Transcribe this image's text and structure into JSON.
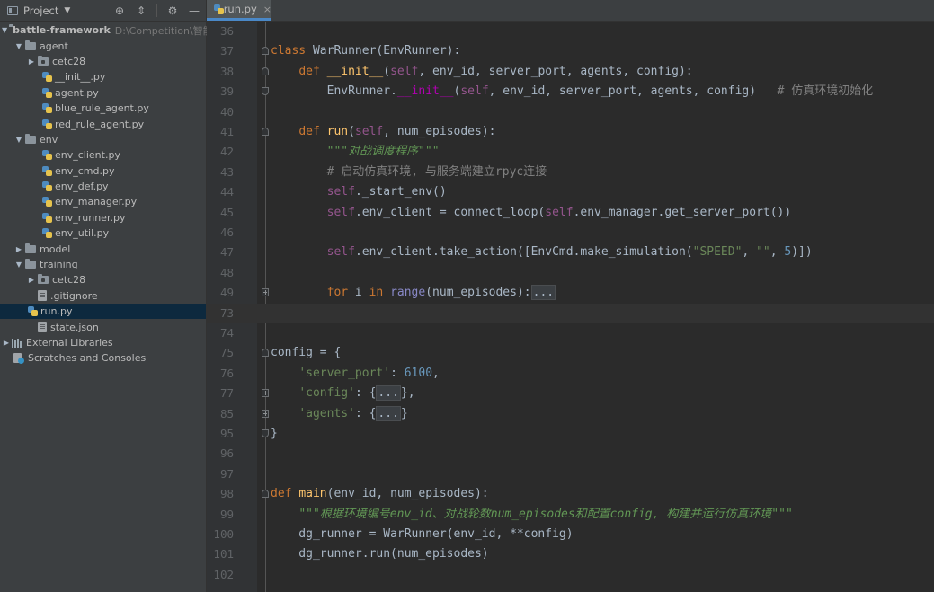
{
  "project_panel": {
    "title": "Project",
    "root_name": "battle-framework",
    "root_path": "D:\\Competition\\智能",
    "items": [
      {
        "label": "agent",
        "type": "folder",
        "expanded": true,
        "depth": 1
      },
      {
        "label": "cetc28",
        "type": "package",
        "expanded": false,
        "depth": 2
      },
      {
        "label": "__init__.py",
        "type": "py",
        "depth": 3
      },
      {
        "label": "agent.py",
        "type": "py",
        "depth": 3
      },
      {
        "label": "blue_rule_agent.py",
        "type": "py",
        "depth": 3
      },
      {
        "label": "red_rule_agent.py",
        "type": "py",
        "depth": 3
      },
      {
        "label": "env",
        "type": "folder",
        "expanded": true,
        "depth": 1
      },
      {
        "label": "env_client.py",
        "type": "py",
        "depth": 3
      },
      {
        "label": "env_cmd.py",
        "type": "py",
        "depth": 3
      },
      {
        "label": "env_def.py",
        "type": "py",
        "depth": 3
      },
      {
        "label": "env_manager.py",
        "type": "py",
        "depth": 3
      },
      {
        "label": "env_runner.py",
        "type": "py",
        "depth": 3
      },
      {
        "label": "env_util.py",
        "type": "py",
        "depth": 3
      },
      {
        "label": "model",
        "type": "folder",
        "expanded": false,
        "depth": 1
      },
      {
        "label": "training",
        "type": "folder",
        "expanded": true,
        "depth": 1
      },
      {
        "label": "cetc28",
        "type": "package",
        "expanded": false,
        "depth": 2
      },
      {
        "label": ".gitignore",
        "type": "file",
        "depth": 2
      },
      {
        "label": "run.py",
        "type": "py",
        "depth": 2,
        "selected": true
      },
      {
        "label": "state.json",
        "type": "file",
        "depth": 2
      },
      {
        "label": "External Libraries",
        "type": "lib",
        "expanded": false,
        "depth": 0
      },
      {
        "label": "Scratches and Consoles",
        "type": "scratch",
        "depth": 0
      }
    ]
  },
  "editor": {
    "tab_label": "run.py",
    "current_line": "73",
    "lines": [
      {
        "n": "36",
        "t": ""
      },
      {
        "n": "37",
        "t": "class WarRunner(EnvRunner):"
      },
      {
        "n": "38",
        "t": "    def __init__(self, env_id, server_port, agents, config):"
      },
      {
        "n": "39",
        "t": "        EnvRunner.__init__(self, env_id, server_port, agents, config)   # 仿真环境初始化"
      },
      {
        "n": "40",
        "t": ""
      },
      {
        "n": "41",
        "t": "    def run(self, num_episodes):"
      },
      {
        "n": "42",
        "t": "        \"\"\"对战调度程序\"\"\""
      },
      {
        "n": "43",
        "t": "        # 启动仿真环境, 与服务端建立rpyc连接"
      },
      {
        "n": "44",
        "t": "        self._start_env()"
      },
      {
        "n": "45",
        "t": "        self.env_client = connect_loop(self.env_manager.get_server_port())"
      },
      {
        "n": "46",
        "t": ""
      },
      {
        "n": "47",
        "t": "        self.env_client.take_action([EnvCmd.make_simulation(\"SPEED\", \"\", 5)])"
      },
      {
        "n": "48",
        "t": ""
      },
      {
        "n": "49",
        "t": "        for i in range(num_episodes):..."
      },
      {
        "n": "73",
        "t": ""
      },
      {
        "n": "74",
        "t": ""
      },
      {
        "n": "75",
        "t": "config = {"
      },
      {
        "n": "76",
        "t": "    'server_port': 6100,"
      },
      {
        "n": "77",
        "t": "    'config': {...},"
      },
      {
        "n": "85",
        "t": "    'agents': {...}"
      },
      {
        "n": "95",
        "t": "}"
      },
      {
        "n": "96",
        "t": ""
      },
      {
        "n": "97",
        "t": ""
      },
      {
        "n": "98",
        "t": "def main(env_id, num_episodes):"
      },
      {
        "n": "99",
        "t": "    \"\"\"根据环境编号env_id、对战轮数num_episodes和配置config, 构建并运行仿真环境\"\"\""
      },
      {
        "n": "100",
        "t": "    dg_runner = WarRunner(env_id, **config)"
      },
      {
        "n": "101",
        "t": "    dg_runner.run(num_episodes)"
      },
      {
        "n": "102",
        "t": ""
      }
    ]
  },
  "colors": {
    "keyword": "#cc7832",
    "function": "#ffc66d",
    "self": "#94558d",
    "dunder": "#b200b2",
    "string": "#6a8759",
    "number": "#6897bb",
    "comment": "#808080",
    "docstring": "#629755",
    "text": "#a9b7c6"
  }
}
